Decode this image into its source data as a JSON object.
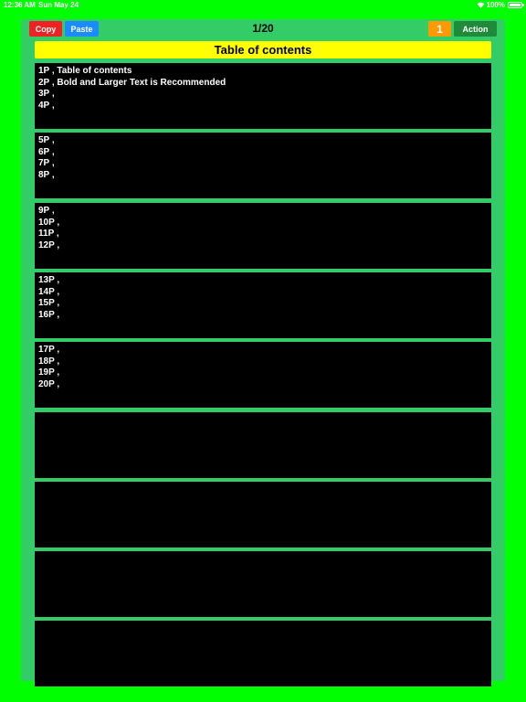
{
  "status_bar": {
    "time": "12:36 AM",
    "date": "Sun May 24",
    "battery": "100%"
  },
  "toolbar": {
    "copy_label": "Copy",
    "paste_label": "Paste",
    "page_indicator": "1/20",
    "count_label": "1",
    "action_label": "Action"
  },
  "toc": {
    "title": "Table of contents"
  },
  "cards": [
    {
      "lines": [
        "1P , Table of contents",
        "2P , Bold and Larger Text is Recommended",
        "3P ,",
        "4P ,"
      ]
    },
    {
      "lines": [
        "5P ,",
        "6P ,",
        "7P ,",
        "8P ,"
      ]
    },
    {
      "lines": [
        "9P ,",
        "10P ,",
        "11P ,",
        "12P ,"
      ]
    },
    {
      "lines": [
        "13P ,",
        "14P ,",
        "15P ,",
        "16P ,"
      ]
    },
    {
      "lines": [
        "17P ,",
        "18P ,",
        "19P ,",
        "20P ,"
      ]
    },
    {
      "lines": []
    },
    {
      "lines": []
    },
    {
      "lines": []
    },
    {
      "lines": []
    }
  ],
  "colors": {
    "background": "#00ff00",
    "panel": "#33cc66",
    "copy": "#ee2222",
    "paste": "#1a8cff",
    "count": "#ff9900",
    "action": "#1f8a3a",
    "header": "#ffff00",
    "card": "#000000"
  },
  "icons": [
    "wifi-icon",
    "battery-icon"
  ]
}
